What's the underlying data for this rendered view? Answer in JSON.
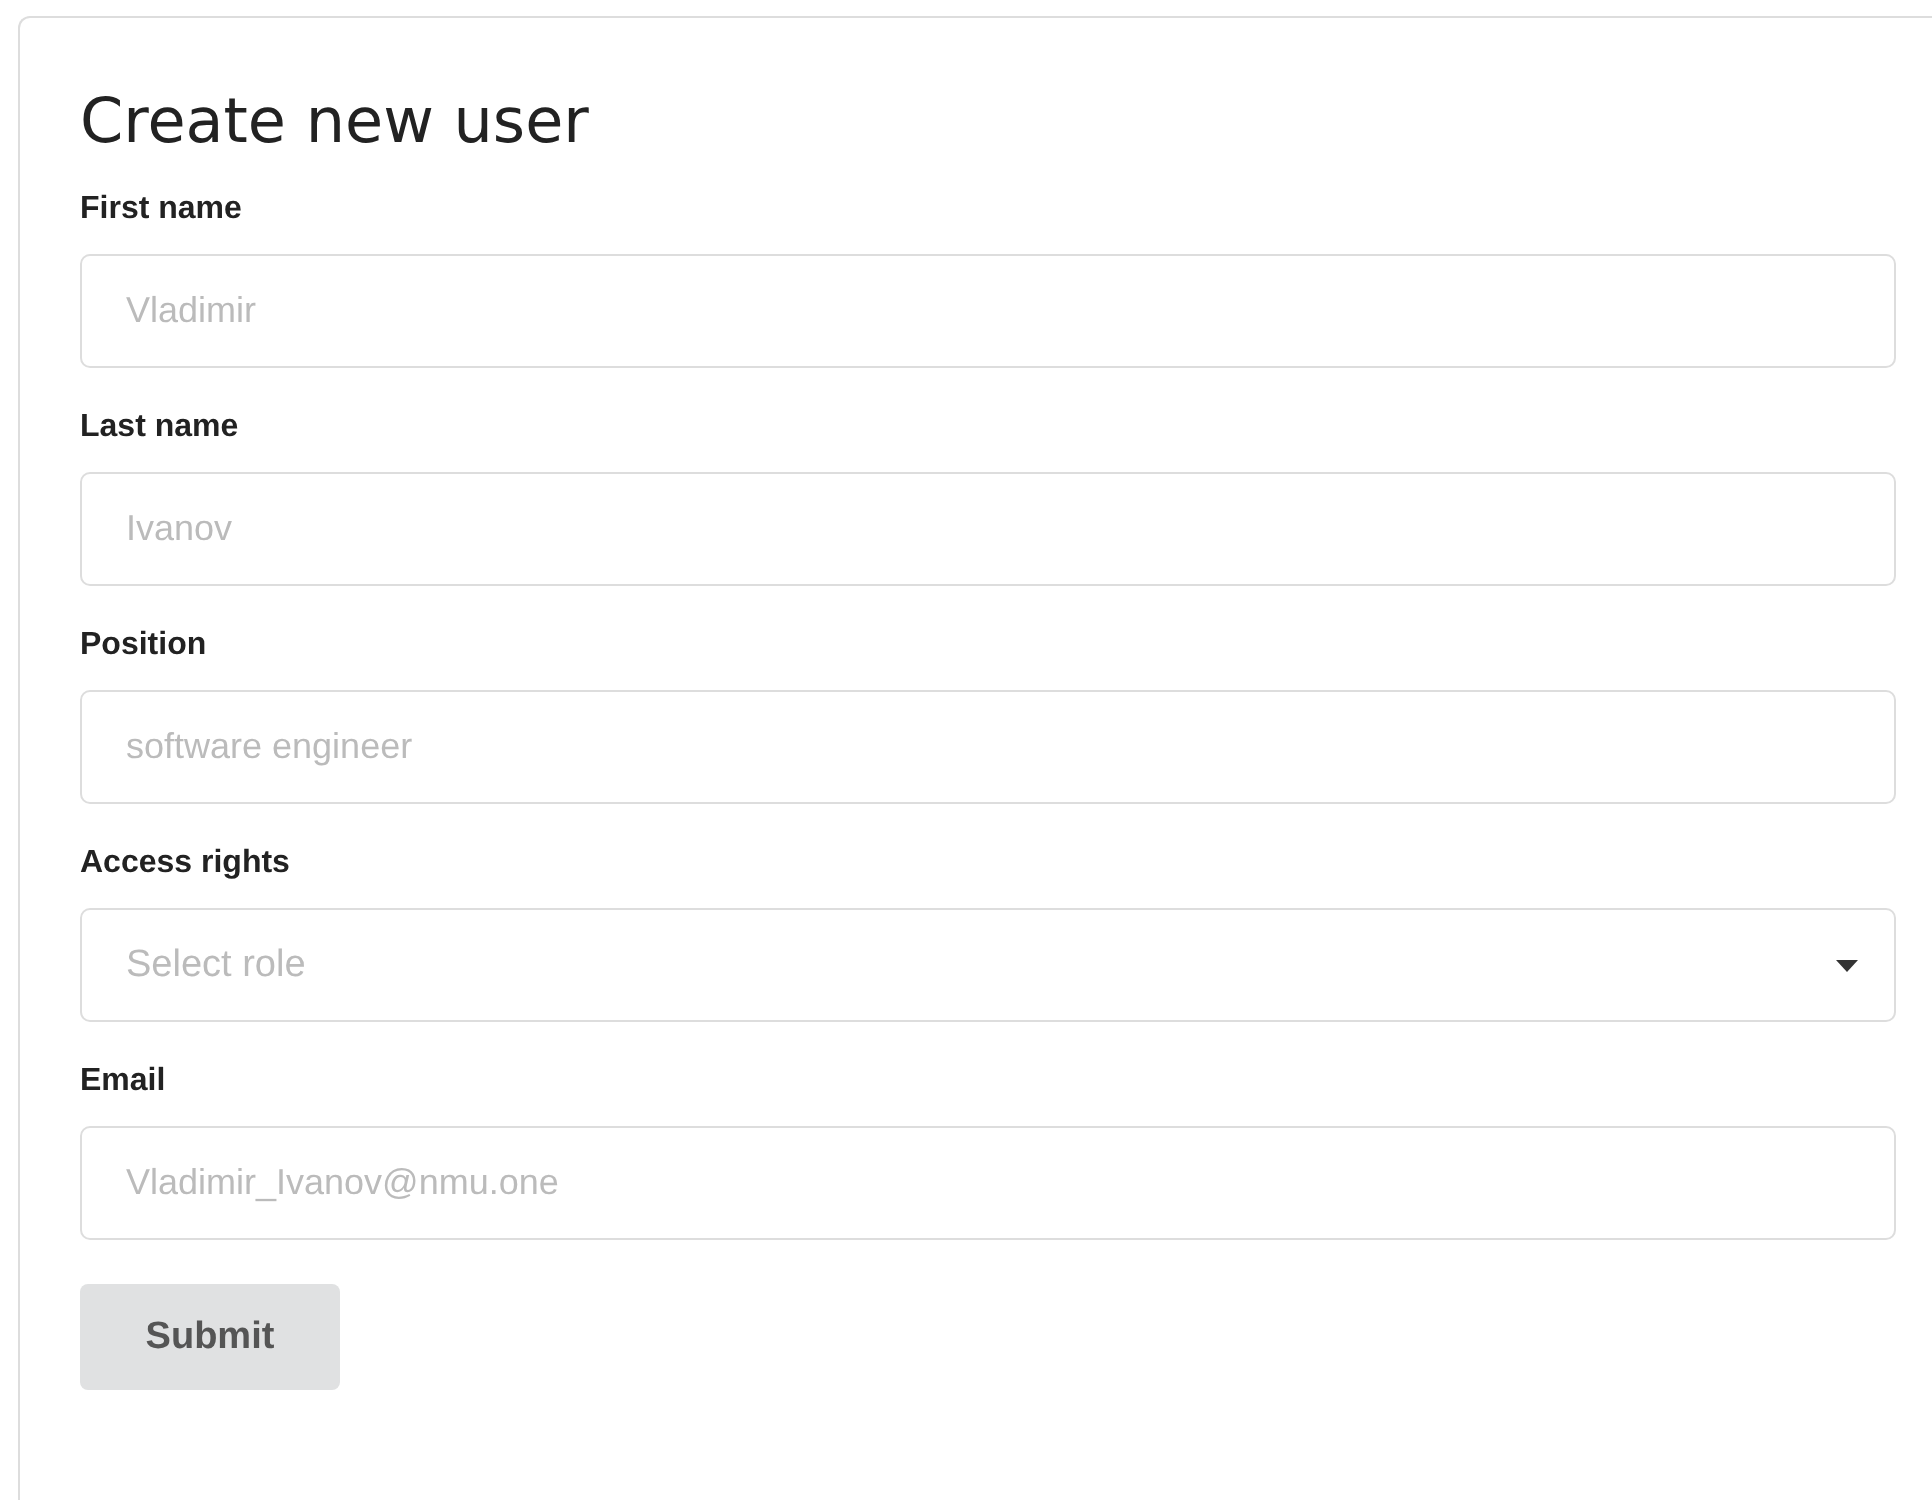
{
  "title": "Create new user",
  "fields": [
    {
      "kind": "text",
      "label": "First name",
      "placeholder": "Vladimir"
    },
    {
      "kind": "text",
      "label": "Last name",
      "placeholder": "Ivanov"
    },
    {
      "kind": "text",
      "label": "Position",
      "placeholder": "software engineer"
    },
    {
      "kind": "select",
      "label": "Access rights",
      "placeholder": "Select role"
    },
    {
      "kind": "text",
      "label": "Email",
      "placeholder": "Vladimir_Ivanov@nmu.one"
    }
  ],
  "submit": {
    "label": "Submit"
  }
}
